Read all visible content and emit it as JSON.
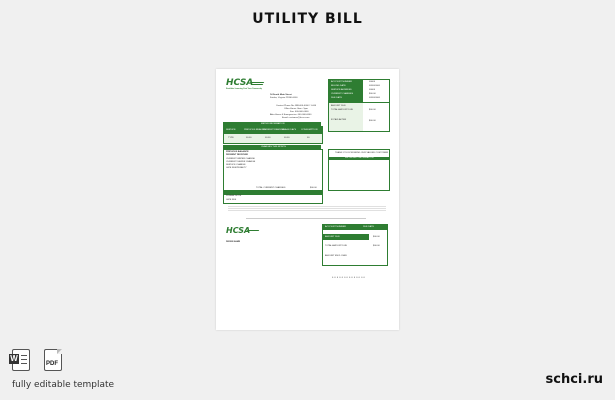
{
  "page": {
    "title": "UTILITY BILL",
    "caption": "fully editable template",
    "brand": "schci.ru",
    "pdf_label": "PDF",
    "word_letter": "W"
  },
  "colors": {
    "accent": "#2e7d32",
    "background": "#f0f0f0"
  },
  "icons": [
    "word-document-icon",
    "pdf-document-icon"
  ],
  "bill": {
    "logo": "HCSA",
    "logo_tagline": "Stealthier Lowering Cost Your Community",
    "address_lines": [
      "14 South Main Street",
      "Fairfax, Virginia 22030-0000"
    ],
    "contact_lines": [
      "Contact Phone No: 888-000-0000 / 1-000",
      "Office Hours: 8am - 5pm",
      "Fax: 000-000-0000",
      "After Hours & Emergencies: 000-000-0000",
      "Email: customer@hcsa.com"
    ],
    "summary_labels": [
      "ACCOUNT NUMBER",
      "BILLING DATE",
      "SERVICE ADDRESS",
      "CURRENT CHARGES",
      "DUE DATE"
    ],
    "summary_values": [
      "00000",
      "00/00/0000",
      "00000",
      "$00.00",
      "00/00/0000"
    ],
    "amount_due_labels": [
      "AMOUNT DUE",
      "TOTAL AMOUNT DUE",
      "IF PAID AFTER"
    ],
    "amount_due_values": [
      "$00.00",
      "$00.00"
    ],
    "meter_header": "METER INFORMATION",
    "meter_columns": [
      "SERVICE",
      "PREVIOUS READING",
      "CURRENT READING",
      "USAGE DAYS",
      "CONSUMPTION"
    ],
    "meter_row": [
      "TYPE",
      "00.00",
      "00.00",
      "00.00",
      "00"
    ],
    "charges_header": "CHARGES THIS MONTH",
    "charges_rows": [
      "PREVIOUS BALANCE",
      "PAYMENT RECEIVED",
      "CURRENT WATER CHARGE",
      "CURRENT SEWER CHARGE",
      "SERVICE CHARGE",
      "LATE FEE/PENALTY"
    ],
    "charges_total_label": "TOTAL CURRENT CHARGES",
    "charges_total_value": "$00.00",
    "messages_header": "MESSAGES",
    "messages_rows": [
      "PLEASE NOTE",
      "LATE FEE"
    ],
    "notice_header": "IMPORTANT INFORMATION",
    "notice_text": "THANK YOU FOR BEING OUR VALUED CUSTOMER",
    "stub_logo": "HCSA",
    "stub_name": "PAYEE NAME",
    "stub_table_headers": [
      "ACCOUNT NUMBER",
      "DUE DATE"
    ],
    "stub_rows": [
      "AMOUNT DUE",
      "TOTAL AMOUNT DUE",
      "AMOUNT ENCLOSED"
    ],
    "stub_values": [
      "$00.00",
      "$00.00"
    ],
    "barcode": "0 0 0 0 0 0 0 0 0 0 0 0 0 0"
  }
}
